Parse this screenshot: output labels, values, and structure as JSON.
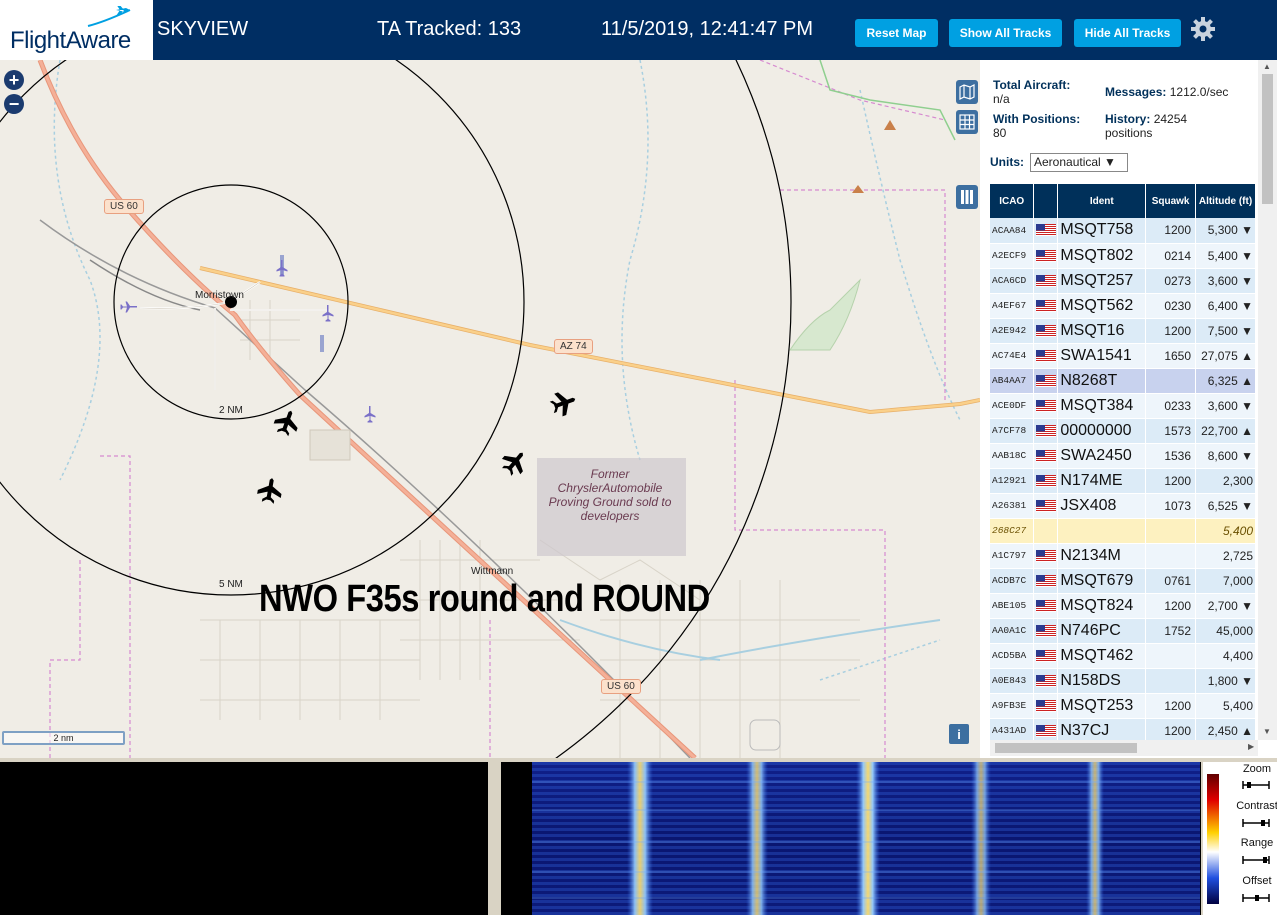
{
  "header": {
    "logo_text": "FlightAware",
    "app_title": "SKYVIEW",
    "ta_tracked": "TA Tracked: 133",
    "clock": "11/5/2019, 12:41:47 PM",
    "buttons": {
      "reset_map": "Reset Map",
      "show_all_tracks": "Show All Tracks",
      "hide_all_tracks": "Hide All Tracks"
    },
    "accent_color": "#00a0e2",
    "bar_color": "#002e63"
  },
  "map": {
    "zoom_in": "+",
    "zoom_out": "−",
    "labels": {
      "town_1": "Morristown",
      "town_2": "Wittmann",
      "road_1": "US 60",
      "road_2": "AZ 74",
      "road_3": "US 60",
      "ring_1": "2 NM",
      "ring_2": "5 NM",
      "proving_ground": "Former ChryslerAutomobile Proving Ground sold to developers"
    },
    "overlay_text": "NWO F35s round and ROUND",
    "scale": "2 nm",
    "info_button": "i"
  },
  "stats": {
    "total_aircraft_label": "Total Aircraft:",
    "total_aircraft_value": "n/a",
    "messages_label": "Messages:",
    "messages_value": "1212.0/sec",
    "with_positions_label": "With Positions:",
    "with_positions_value": "80",
    "history_label": "History:",
    "history_value": "24254",
    "history_unit": "positions"
  },
  "units": {
    "label": "Units:",
    "selected": "Aeronautical ▼"
  },
  "table": {
    "headers": {
      "icao": "ICAO",
      "flag": "",
      "ident": "Ident",
      "squawk": "Squawk",
      "altitude": "Altitude (ft)"
    },
    "rows": [
      {
        "icao": "ACAA84",
        "ident": "MSQT758",
        "squawk": "1200",
        "alt": "5,300 ▼",
        "flag": true
      },
      {
        "icao": "A2ECF9",
        "ident": "MSQT802",
        "squawk": "0214",
        "alt": "5,400 ▼",
        "flag": true
      },
      {
        "icao": "ACA6CD",
        "ident": "MSQT257",
        "squawk": "0273",
        "alt": "3,600 ▼",
        "flag": true
      },
      {
        "icao": "A4EF67",
        "ident": "MSQT562",
        "squawk": "0230",
        "alt": "6,400 ▼",
        "flag": true
      },
      {
        "icao": "A2E942",
        "ident": "MSQT16",
        "squawk": "1200",
        "alt": "7,500 ▼",
        "flag": true
      },
      {
        "icao": "AC74E4",
        "ident": "SWA1541",
        "squawk": "1650",
        "alt": "27,075 ▲",
        "flag": true
      },
      {
        "icao": "AB4AA7",
        "ident": "N8268T",
        "squawk": "",
        "alt": "6,325 ▲",
        "flag": true,
        "state": "selected"
      },
      {
        "icao": "ACE0DF",
        "ident": "MSQT384",
        "squawk": "0233",
        "alt": "3,600 ▼",
        "flag": true
      },
      {
        "icao": "A7CF78",
        "ident": "00000000",
        "squawk": "1573",
        "alt": "22,700 ▲",
        "flag": true
      },
      {
        "icao": "AAB18C",
        "ident": "SWA2450",
        "squawk": "1536",
        "alt": "8,600 ▼",
        "flag": true
      },
      {
        "icao": "A12921",
        "ident": "N174ME",
        "squawk": "1200",
        "alt": "2,300",
        "flag": true
      },
      {
        "icao": "A26381",
        "ident": "JSX408",
        "squawk": "1073",
        "alt": "6,525 ▼",
        "flag": true
      },
      {
        "icao": "268C27",
        "ident": "",
        "squawk": "",
        "alt": "5,400",
        "flag": false,
        "state": "highlight"
      },
      {
        "icao": "A1C797",
        "ident": "N2134M",
        "squawk": "",
        "alt": "2,725",
        "flag": true
      },
      {
        "icao": "ACDB7C",
        "ident": "MSQT679",
        "squawk": "0761",
        "alt": "7,000",
        "flag": true
      },
      {
        "icao": "ABE105",
        "ident": "MSQT824",
        "squawk": "1200",
        "alt": "2,700 ▼",
        "flag": true
      },
      {
        "icao": "AA0A1C",
        "ident": "N746PC",
        "squawk": "1752",
        "alt": "45,000",
        "flag": true
      },
      {
        "icao": "ACD5BA",
        "ident": "MSQT462",
        "squawk": "",
        "alt": "4,400",
        "flag": true
      },
      {
        "icao": "A0E843",
        "ident": "N158DS",
        "squawk": "",
        "alt": "1,800 ▼",
        "flag": true
      },
      {
        "icao": "A9FB3E",
        "ident": "MSQT253",
        "squawk": "1200",
        "alt": "5,400",
        "flag": true
      },
      {
        "icao": "A431AD",
        "ident": "N37CJ",
        "squawk": "1200",
        "alt": "2,450 ▲",
        "flag": true
      }
    ]
  },
  "waterfall": {
    "controls": {
      "zoom": "Zoom",
      "contrast": "Contrast",
      "range": "Range",
      "offset": "Offset"
    }
  }
}
